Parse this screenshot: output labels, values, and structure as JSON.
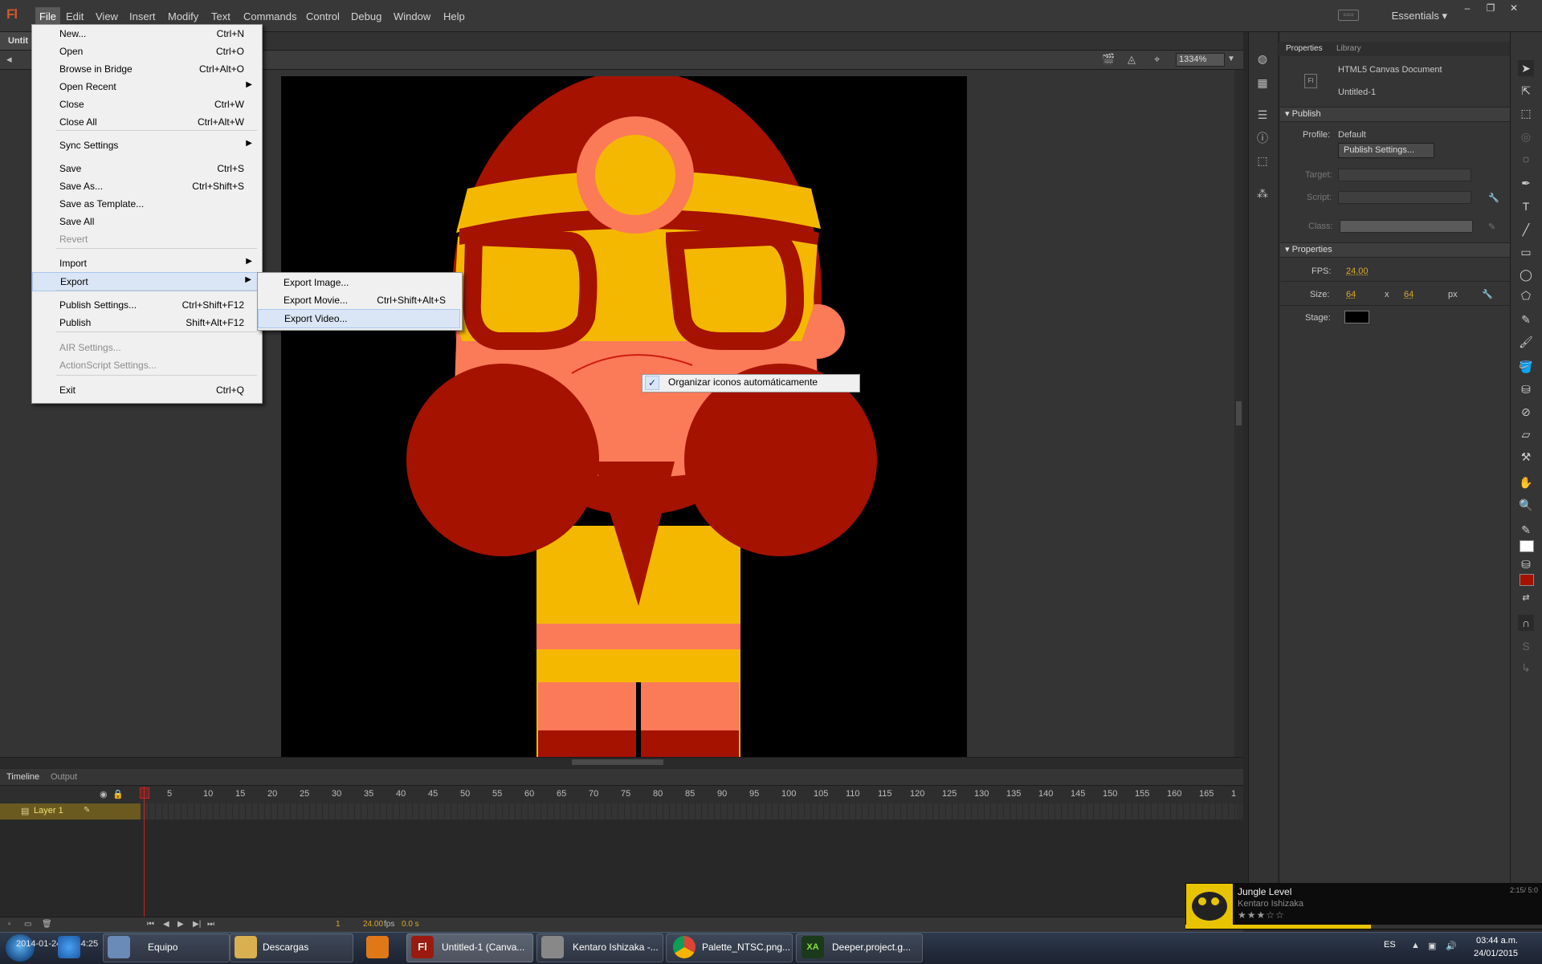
{
  "app": {
    "logo": "Fl",
    "menus": [
      "File",
      "Edit",
      "View",
      "Insert",
      "Modify",
      "Text",
      "Commands",
      "Control",
      "Debug",
      "Window",
      "Help"
    ],
    "workspace": "Essentials",
    "doc_tab": "Untit"
  },
  "file_menu": {
    "items": [
      {
        "label": "New...",
        "shortcut": "Ctrl+N"
      },
      {
        "label": "Open",
        "shortcut": "Ctrl+O"
      },
      {
        "label": "Browse in Bridge",
        "shortcut": "Ctrl+Alt+O"
      },
      {
        "label": "Open Recent",
        "shortcut": ""
      },
      {
        "label": "Close",
        "shortcut": "Ctrl+W"
      },
      {
        "label": "Close All",
        "shortcut": "Ctrl+Alt+W"
      },
      {
        "label": "Sync Settings",
        "shortcut": ""
      },
      {
        "label": "Save",
        "shortcut": "Ctrl+S"
      },
      {
        "label": "Save As...",
        "shortcut": "Ctrl+Shift+S"
      },
      {
        "label": "Save as Template...",
        "shortcut": ""
      },
      {
        "label": "Save All",
        "shortcut": ""
      },
      {
        "label": "Revert",
        "shortcut": ""
      },
      {
        "label": "Import",
        "shortcut": ""
      },
      {
        "label": "Export",
        "shortcut": ""
      },
      {
        "label": "Publish Settings...",
        "shortcut": "Ctrl+Shift+F12"
      },
      {
        "label": "Publish",
        "shortcut": "Shift+Alt+F12"
      },
      {
        "label": "AIR Settings...",
        "shortcut": ""
      },
      {
        "label": "ActionScript Settings...",
        "shortcut": ""
      },
      {
        "label": "Exit",
        "shortcut": "Ctrl+Q"
      }
    ]
  },
  "export_submenu": {
    "items": [
      {
        "label": "Export Image...",
        "shortcut": ""
      },
      {
        "label": "Export Movie...",
        "shortcut": "Ctrl+Shift+Alt+S"
      },
      {
        "label": "Export Video...",
        "shortcut": ""
      }
    ]
  },
  "context_menu": {
    "label": "Organizar iconos automáticamente",
    "check": "✓"
  },
  "editbar": {
    "zoom": "1334%"
  },
  "timeline": {
    "tabs": [
      "Timeline",
      "Output"
    ],
    "layer": "Layer 1",
    "ticks": [
      "5",
      "10",
      "15",
      "20",
      "25",
      "30",
      "35",
      "40",
      "45",
      "50",
      "55",
      "60",
      "65",
      "70",
      "75",
      "80",
      "85",
      "90",
      "95",
      "100",
      "105",
      "110",
      "115",
      "120",
      "125",
      "130",
      "135",
      "140",
      "145",
      "150",
      "155",
      "160",
      "165",
      "1"
    ],
    "footer": {
      "frame": "1",
      "fps": "24.00",
      "fps_unit": "fps",
      "time": "0.0 s"
    }
  },
  "properties": {
    "tabs": [
      "Properties",
      "Library"
    ],
    "doc_type": "HTML5 Canvas Document",
    "doc_name": "Untitled-1",
    "publish": {
      "header": "Publish",
      "profile_label": "Profile:",
      "profile_value": "Default",
      "settings_button": "Publish Settings...",
      "target_label": "Target:",
      "script_label": "Script:",
      "class_label": "Class:"
    },
    "props": {
      "header": "Properties",
      "fps_label": "FPS:",
      "fps_value": "24.00",
      "size_label": "Size:",
      "width": "64",
      "x": "x",
      "height": "64",
      "unit": "px",
      "stage_label": "Stage:",
      "stage_color": "#000000"
    }
  },
  "media": {
    "title": "Jungle Level",
    "artist": "Kentaro Ishizaka",
    "stars": "★★★☆☆",
    "time": "2:15/ 5:0",
    "progress": 0.52
  },
  "taskbar": {
    "items": [
      {
        "label": "Equipo"
      },
      {
        "label": "Descargas"
      },
      {
        "label": "Untitled-1 (Canva..."
      },
      {
        "label": "Kentaro Ishizaka -..."
      },
      {
        "label": "Palette_NTSC.png..."
      },
      {
        "label": "Deeper.project.g..."
      }
    ],
    "overlay_text": "2014-01-24 03:44:25",
    "lang": "ES",
    "time": "03:44 a.m.",
    "date": "24/01/2015"
  },
  "colors": {
    "stage_bg": "#000000",
    "dark_red": "#a51200",
    "yellow": "#f5b800",
    "salmon": "#fb7a58",
    "accent_orange": "#d9a92a"
  }
}
